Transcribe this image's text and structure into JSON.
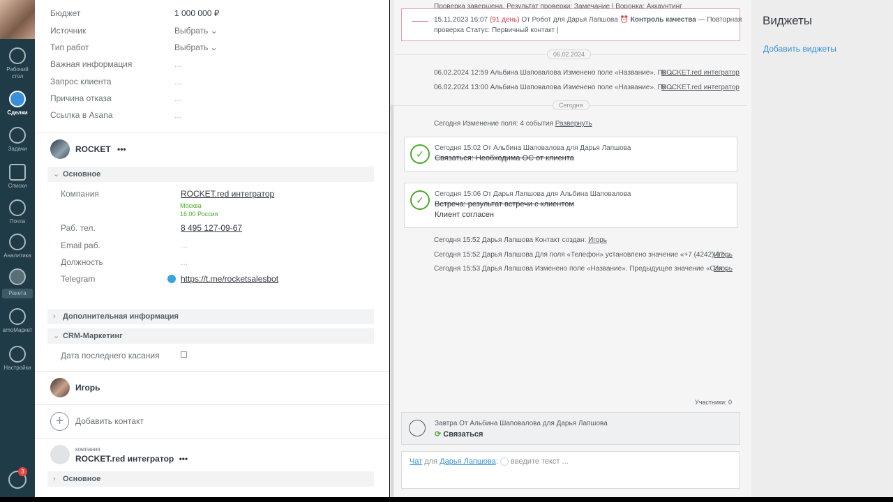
{
  "sidebar": {
    "items": [
      {
        "label": "Рабочий стол",
        "icon": "dashboard-icon"
      },
      {
        "label": "Сделки",
        "icon": "deals-icon"
      },
      {
        "label": "Задачи",
        "icon": "tasks-icon"
      },
      {
        "label": "Списки",
        "icon": "lists-icon"
      },
      {
        "label": "Почта",
        "icon": "mail-icon"
      },
      {
        "label": "Аналитика",
        "icon": "analytics-icon"
      },
      {
        "label": "Ракета",
        "icon": "rocket-icon"
      },
      {
        "label": "amoМаркет",
        "icon": "market-icon"
      },
      {
        "label": "Настройки",
        "icon": "settings-icon"
      }
    ],
    "chat_badge": "3"
  },
  "fields": [
    {
      "label": "Бюджет",
      "value": "1 000 000 ₽"
    },
    {
      "label": "Источник",
      "value": "Выбрать ⌄"
    },
    {
      "label": "Тип работ",
      "value": "Выбрать ⌄"
    },
    {
      "label": "Важная информация",
      "value": "..."
    },
    {
      "label": "Запрос клиента",
      "value": "..."
    },
    {
      "label": "Причина отказа",
      "value": "..."
    },
    {
      "label": "Ссылка в Asana",
      "value": "..."
    }
  ],
  "contact_company": {
    "name": "ROCKET",
    "more": "•••",
    "section_main": "Основное",
    "company_label": "Компания",
    "company_value": "ROCKET.red интегратор",
    "city": "Москва",
    "time": "16:00 Россия",
    "phone_label": "Раб. тел.",
    "phone_value": "8 495 127-09-67",
    "email_label": "Email раб.",
    "email_value": "...",
    "position_label": "Должность",
    "position_value": "...",
    "telegram_label": "Telegram",
    "telegram_value": "https://t.me/rocketsalesbot",
    "section_extra": "Дополнительная информация",
    "section_crm": "CRM-Маркетинг",
    "last_touch_label": "Дата последнего касания"
  },
  "contact_igor": {
    "name": "Игорь"
  },
  "add_contact": "Добавить контакт",
  "company_block": {
    "caption": "компания",
    "name": "ROCKET.red интегратор",
    "more": "•••",
    "section_main": "Основное"
  },
  "feed": {
    "top_line": "Проверка завершена. Результат проверки: Замечание | Воронка: Аккаунтинг",
    "alert_date": "15.11.2023 16:07",
    "alert_days": "(91 день)",
    "alert_from": "От Робот для Дарья Лапшова",
    "alert_type": "Контроль качества",
    "alert_text1": " — Повторная",
    "alert_text2": "проверка Статус: Первичный контакт |",
    "pill_date": "06.02.2024",
    "ev1": "06.02.2024 12:59 Альбина Шаповалова Изменено поле «Название». Пр ⌄",
    "ev1_link": "ROCKET.red интегратор",
    "ev2": "06.02.2024 13:00 Альбина Шаповалова Изменено поле «Название». Пр ⌄",
    "ev2_link": "ROCKET.red интегратор",
    "pill_today": "Сегодня",
    "changes": "Сегодня Изменение поля: 4 события",
    "expand": "Развернуть",
    "card1_head": "Сегодня 15:02  От Альбина Шаповалова для Дарья Лапшова",
    "card1_text": "Связаться: Необходима ОС от клиента",
    "card2_head": "Сегодня 15:06  От Дарья Лапшова для Альбина Шаповалова",
    "card2_text": "Встреча: результат встречи с клиентом",
    "card2_result": "Клиент согласен",
    "ev3": "Сегодня 15:52 Дарья Лапшова Контакт создан:",
    "ev3_link": "Игорь",
    "ev4": "Сегодня 15:52 Дарья Лапшова Для поля «Телефон» установлено значение «+7 (4242) 6? ⌄",
    "ev4_link": "Игорь",
    "ev5": "Сегодня 15:53 Дарья Лапшова Изменено поле «Название». Предыдущее значение «Сах ⌄",
    "ev5_link": "Игорь",
    "participants": "Участники: 0",
    "task_head": "Завтра От Альбина Шаповалова для Дарья Лапшова",
    "task_text": "Связаться",
    "chat_label": "Чат",
    "chat_for": "для",
    "chat_user": "Дарья Лапшова",
    "chat_placeholder": "введите текст ..."
  },
  "widgets": {
    "title": "Виджеты",
    "add": "Добавить виджеты"
  }
}
